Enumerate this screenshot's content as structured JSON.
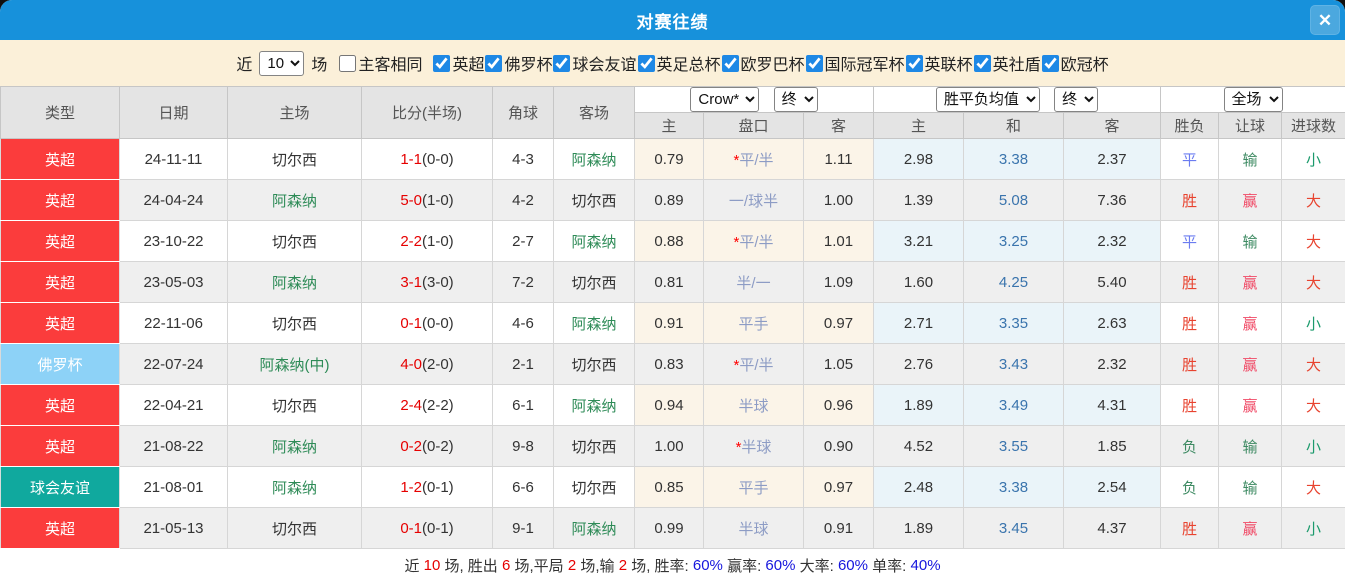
{
  "dialog": {
    "title": "对赛往绩",
    "close_icon": "✕"
  },
  "filters": {
    "near_label": "近",
    "near_value": "10",
    "games_label": "场",
    "same_venue": {
      "label": "主客相同",
      "checked": false
    },
    "competitions": [
      {
        "label": "英超",
        "checked": true
      },
      {
        "label": "佛罗杯",
        "checked": true
      },
      {
        "label": "球会友谊",
        "checked": true
      },
      {
        "label": "英足总杯",
        "checked": true
      },
      {
        "label": "欧罗巴杯",
        "checked": true
      },
      {
        "label": "国际冠军杯",
        "checked": true
      },
      {
        "label": "英联杯",
        "checked": true
      },
      {
        "label": "英社盾",
        "checked": true
      },
      {
        "label": "欧冠杯",
        "checked": true
      }
    ]
  },
  "table": {
    "headers": {
      "type": "类型",
      "date": "日期",
      "home": "主场",
      "score": "比分(半场)",
      "corners": "角球",
      "away": "客场",
      "ah_home": "主",
      "ah_line": "盘口",
      "ah_away": "客",
      "avg_home": "主",
      "avg_draw": "和",
      "avg_away": "客",
      "result": "胜负",
      "spread": "让球",
      "total": "进球数"
    },
    "dropdowns": {
      "company": "Crow*",
      "company_time": "终",
      "avg_type": "胜平负均值",
      "avg_time": "终",
      "scope": "全场"
    },
    "rows": [
      {
        "type": "英超",
        "date": "24-11-11",
        "home": "切尔西",
        "score": "1-1",
        "half": "(0-0)",
        "corners": "4-3",
        "away": "阿森纳",
        "ah_home": "0.79",
        "ah_line": "*平/半",
        "ah_away": "1.11",
        "avg_home": "2.98",
        "avg_draw": "3.38",
        "avg_away": "2.37",
        "result": "平",
        "spread": "输",
        "total": "小"
      },
      {
        "type": "英超",
        "date": "24-04-24",
        "home": "阿森纳",
        "score": "5-0",
        "half": "(1-0)",
        "corners": "4-2",
        "away": "切尔西",
        "ah_home": "0.89",
        "ah_line": "一/球半",
        "ah_away": "1.00",
        "avg_home": "1.39",
        "avg_draw": "5.08",
        "avg_away": "7.36",
        "result": "胜",
        "spread": "赢",
        "total": "大"
      },
      {
        "type": "英超",
        "date": "23-10-22",
        "home": "切尔西",
        "score": "2-2",
        "half": "(1-0)",
        "corners": "2-7",
        "away": "阿森纳",
        "ah_home": "0.88",
        "ah_line": "*平/半",
        "ah_away": "1.01",
        "avg_home": "3.21",
        "avg_draw": "3.25",
        "avg_away": "2.32",
        "result": "平",
        "spread": "输",
        "total": "大"
      },
      {
        "type": "英超",
        "date": "23-05-03",
        "home": "阿森纳",
        "score": "3-1",
        "half": "(3-0)",
        "corners": "7-2",
        "away": "切尔西",
        "ah_home": "0.81",
        "ah_line": "半/一",
        "ah_away": "1.09",
        "avg_home": "1.60",
        "avg_draw": "4.25",
        "avg_away": "5.40",
        "result": "胜",
        "spread": "赢",
        "total": "大"
      },
      {
        "type": "英超",
        "date": "22-11-06",
        "home": "切尔西",
        "score": "0-1",
        "half": "(0-0)",
        "corners": "4-6",
        "away": "阿森纳",
        "ah_home": "0.91",
        "ah_line": "平手",
        "ah_away": "0.97",
        "avg_home": "2.71",
        "avg_draw": "3.35",
        "avg_away": "2.63",
        "result": "胜",
        "spread": "赢",
        "total": "小"
      },
      {
        "type": "佛罗杯",
        "date": "22-07-24",
        "home": "阿森纳(中)",
        "score": "4-0",
        "half": "(2-0)",
        "corners": "2-1",
        "away": "切尔西",
        "ah_home": "0.83",
        "ah_line": "*平/半",
        "ah_away": "1.05",
        "avg_home": "2.76",
        "avg_draw": "3.43",
        "avg_away": "2.32",
        "result": "胜",
        "spread": "赢",
        "total": "大"
      },
      {
        "type": "英超",
        "date": "22-04-21",
        "home": "切尔西",
        "score": "2-4",
        "half": "(2-2)",
        "corners": "6-1",
        "away": "阿森纳",
        "ah_home": "0.94",
        "ah_line": "半球",
        "ah_away": "0.96",
        "avg_home": "1.89",
        "avg_draw": "3.49",
        "avg_away": "4.31",
        "result": "胜",
        "spread": "赢",
        "total": "大"
      },
      {
        "type": "英超",
        "date": "21-08-22",
        "home": "阿森纳",
        "score": "0-2",
        "half": "(0-2)",
        "corners": "9-8",
        "away": "切尔西",
        "ah_home": "1.00",
        "ah_line": "*半球",
        "ah_away": "0.90",
        "avg_home": "4.52",
        "avg_draw": "3.55",
        "avg_away": "1.85",
        "result": "负",
        "spread": "输",
        "total": "小"
      },
      {
        "type": "球会友谊",
        "date": "21-08-01",
        "home": "阿森纳",
        "score": "1-2",
        "half": "(0-1)",
        "corners": "6-6",
        "away": "切尔西",
        "ah_home": "0.85",
        "ah_line": "平手",
        "ah_away": "0.97",
        "avg_home": "2.48",
        "avg_draw": "3.38",
        "avg_away": "2.54",
        "result": "负",
        "spread": "输",
        "total": "大"
      },
      {
        "type": "英超",
        "date": "21-05-13",
        "home": "切尔西",
        "score": "0-1",
        "half": "(0-1)",
        "corners": "9-1",
        "away": "阿森纳",
        "ah_home": "0.99",
        "ah_line": "半球",
        "ah_away": "0.91",
        "avg_home": "1.89",
        "avg_draw": "3.45",
        "avg_away": "4.37",
        "result": "胜",
        "spread": "赢",
        "total": "小"
      }
    ]
  },
  "summary": {
    "segments": [
      {
        "text": "近 ",
        "color": "text"
      },
      {
        "text": "10",
        "color": "red"
      },
      {
        "text": " 场, 胜出 ",
        "color": "text"
      },
      {
        "text": "6",
        "color": "red"
      },
      {
        "text": " 场,平局 ",
        "color": "text"
      },
      {
        "text": "2",
        "color": "red"
      },
      {
        "text": " 场,输 ",
        "color": "text"
      },
      {
        "text": "2",
        "color": "red"
      },
      {
        "text": " 场, 胜率: ",
        "color": "text"
      },
      {
        "text": "60%",
        "color": "blue"
      },
      {
        "text": " 赢率: ",
        "color": "text"
      },
      {
        "text": "60%",
        "color": "blue"
      },
      {
        "text": " 大率: ",
        "color": "text"
      },
      {
        "text": "60%",
        "color": "blue"
      },
      {
        "text": " 单率: ",
        "color": "text"
      },
      {
        "text": "40%",
        "color": "blue"
      }
    ]
  },
  "colors": {
    "titlebar_blue": "#1791db",
    "filter_bg": "#fbf0d9",
    "team_highlight_green": "#2e8b57",
    "score_red": "#e60000",
    "draw_odds_blue": "#3a74ad",
    "handicap_text": "#8d9cc5",
    "type_badges": {
      "英超": "#fb3c3c",
      "佛罗杯": "#8dd2f7",
      "球会友谊": "#10a99e"
    },
    "result_colors": {
      "胜": "#e8432f",
      "平": "#6b7cf0",
      "负": "#3d8a62",
      "赢": "#f04a66",
      "输": "#3d8a62",
      "大": "#e8432f",
      "小": "#1b9a6c"
    }
  }
}
